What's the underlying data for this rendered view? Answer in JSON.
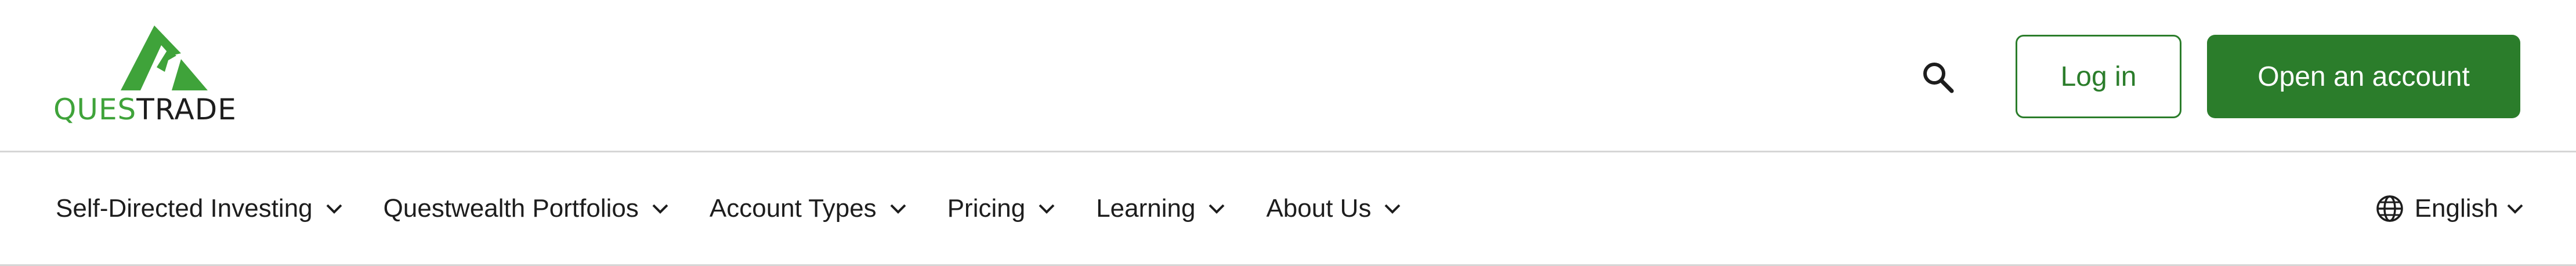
{
  "header": {
    "logo": {
      "word_part1": "QUES",
      "word_part2": "TRADE",
      "brand_green": "#3fa33a"
    },
    "search_icon": "search-icon",
    "login_label": "Log in",
    "open_account_label": "Open an account",
    "accent": "#2b7d2b"
  },
  "nav": {
    "items": [
      {
        "label": "Self-Directed Investing"
      },
      {
        "label": "Questwealth Portfolios"
      },
      {
        "label": "Account Types"
      },
      {
        "label": "Pricing"
      },
      {
        "label": "Learning"
      },
      {
        "label": "About Us"
      }
    ],
    "language_label": "English",
    "language_icon": "globe-icon"
  }
}
